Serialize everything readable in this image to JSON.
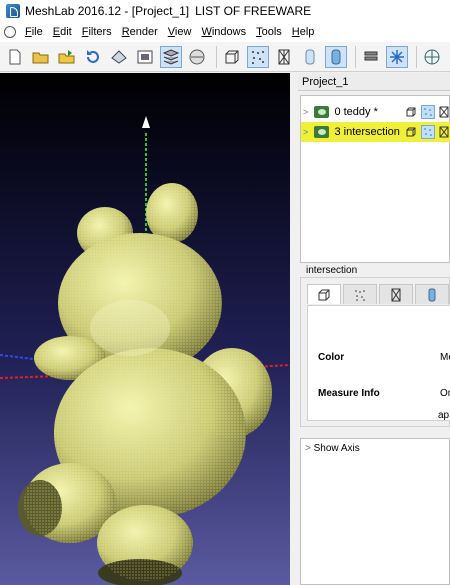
{
  "window": {
    "title": "MeshLab 2016.12 - [Project_1]",
    "caption": "LIST OF FREEWARE"
  },
  "menu": [
    "File",
    "Edit",
    "Filters",
    "Render",
    "View",
    "Windows",
    "Tools",
    "Help"
  ],
  "toolbar": {
    "buttons": [
      {
        "icon": "new-project-icon",
        "active": false
      },
      {
        "icon": "open-project-icon",
        "active": false
      },
      {
        "icon": "import-mesh-icon",
        "active": false
      },
      {
        "icon": "reload-icon",
        "active": false
      },
      {
        "icon": "export-mesh-icon",
        "active": false
      },
      {
        "icon": "snapshot-icon",
        "active": false
      },
      {
        "icon": "layers-icon",
        "active": true
      },
      {
        "icon": "raster-icon",
        "active": false
      },
      {
        "icon": "bounding-box-icon",
        "active": false
      },
      {
        "icon": "points-icon",
        "active": true
      },
      {
        "icon": "wireframe-icon",
        "active": false
      },
      {
        "icon": "flat-shading-icon",
        "active": false
      },
      {
        "icon": "smooth-shading-icon",
        "active": true
      },
      {
        "icon": "align-icon",
        "active": false
      },
      {
        "icon": "manipulator-icon",
        "active": true
      },
      {
        "icon": "globe-icon",
        "active": false
      }
    ]
  },
  "project_panel": {
    "tab_label": "Project_1",
    "layers": [
      {
        "label": "0  teddy *",
        "selected": false
      },
      {
        "label": "3  intersection",
        "selected": true
      }
    ]
  },
  "selection_title": "intersection",
  "properties": {
    "tabs": [
      "bbox-tab-icon",
      "points-tab-icon",
      "wire-tab-icon",
      "shade-tab-icon"
    ],
    "rows": [
      {
        "label": "Color",
        "value": "Me"
      },
      {
        "label": "Measure Info",
        "value": "On"
      }
    ],
    "apply_label": "ap"
  },
  "filter_panel": {
    "item": "Show Axis"
  },
  "colors": {
    "mesh": "#e8e84a",
    "highlight": "#f0f03a",
    "axis_y": "#2fbf3f",
    "axis_x": "#e02020",
    "axis_z": "#2a4fe0"
  }
}
